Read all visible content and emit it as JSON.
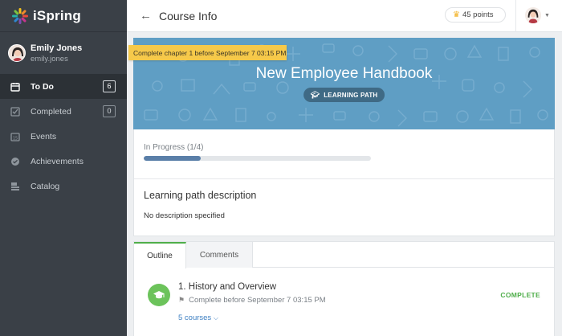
{
  "app": {
    "logo_text": "iSpring"
  },
  "user": {
    "name": "Emily Jones",
    "login": "emily.jones"
  },
  "nav": {
    "items": [
      {
        "label": "To Do",
        "count": "6",
        "icon": "calendar-icon",
        "active": true
      },
      {
        "label": "Completed",
        "count": "0",
        "icon": "checkbox-icon",
        "active": false
      },
      {
        "label": "Events",
        "count": "",
        "icon": "calendar-date-icon",
        "active": false
      },
      {
        "label": "Achievements",
        "count": "",
        "icon": "medal-icon",
        "active": false
      },
      {
        "label": "Catalog",
        "count": "",
        "icon": "catalog-icon",
        "active": false
      }
    ]
  },
  "header": {
    "back_icon": "←",
    "title": "Course Info",
    "points": "45 points"
  },
  "tooltip": "Complete chapter 1 before September 7 03:15 PM",
  "hero": {
    "title": "New Employee Handbook",
    "type_label": "LEARNING PATH",
    "background": "#5f9ec4"
  },
  "progress": {
    "label": "In Progress (1/4)",
    "fraction": 0.25,
    "fill_color": "#5a7fa8"
  },
  "description": {
    "title": "Learning path description",
    "text": "No description specified"
  },
  "tabs": [
    {
      "label": "Outline"
    },
    {
      "label": "Comments"
    }
  ],
  "outline": {
    "items": [
      {
        "title": "1. History and Overview",
        "due": "Complete before September 7 03:15 PM",
        "courses": "5 courses",
        "status": "COMPLETE"
      }
    ]
  },
  "colors": {
    "sidebar": "#3a4047",
    "accent_green": "#4fae4a",
    "link_blue": "#3d7fc2"
  }
}
